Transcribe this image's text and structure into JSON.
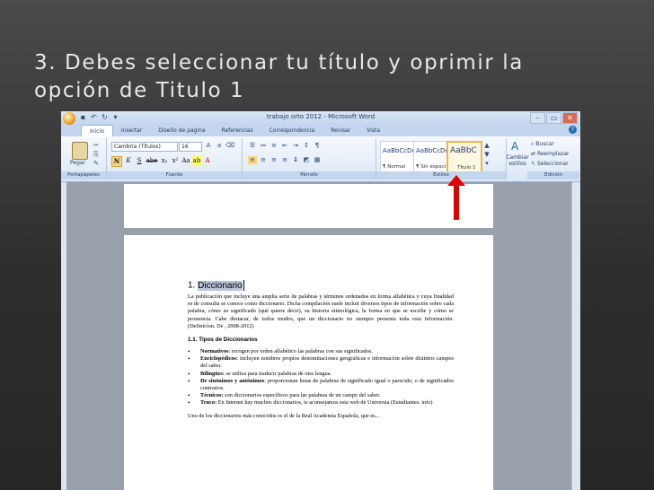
{
  "slide": {
    "title_line1": "3. Debes seleccionar tu título y oprimir la",
    "title_line2": "opción de Titulo 1"
  },
  "window": {
    "title": "trabajo orto 2012 - Microsoft Word",
    "minimize": "–",
    "maximize": "▭",
    "close": "✕"
  },
  "tabs": [
    "Inicio",
    "Insertar",
    "Diseño de página",
    "Referencias",
    "Correspondencia",
    "Revisar",
    "Vista"
  ],
  "ribbon": {
    "clipboard": {
      "paste_label": "Pegar",
      "group_label": "Portapapeles"
    },
    "font": {
      "font_name": "Cambria (Títulos)",
      "font_size": "16",
      "group_label": "Fuente",
      "bold": "N",
      "italic": "K",
      "underline": "S",
      "strike": "abe"
    },
    "paragraph": {
      "group_label": "Párrafo"
    },
    "styles": {
      "group_label": "Estilos",
      "tiles": [
        {
          "sample": "AaBbCcDc",
          "name": "¶ Normal"
        },
        {
          "sample": "AaBbCcDc",
          "name": "¶ Sin espaci..."
        },
        {
          "sample": "AaBbC",
          "name": "Título 1"
        }
      ],
      "change_styles": "Cambiar estilos"
    },
    "editing": {
      "group_label": "Edición",
      "find": "Buscar",
      "replace": "Reemplazar",
      "select": "Seleccionar"
    }
  },
  "document": {
    "heading_num": "1. ",
    "heading_text": "Diccionario",
    "intro": "La publicación que incluye una amplia serie de palabras y términos ordenados en forma alfabética y cuya finalidad es de consulta se conoce como diccionario. Dicha compilación suele incluir diversos tipos de información sobre cada palabra, cómo su significado (qué quiere decir), su historia etimológica, la forma en que se escribe y cómo se pronuncia. Cabe destacar, de todos modos, que un diccionario no siempre presenta toda esta información. (Definicion. De , 2008-2012)",
    "subheading": "1.1. Tipos de Diccionarios",
    "items": [
      {
        "term": "Normativos",
        "desc": ": recogen por orden alfabético las palabras con sus significados."
      },
      {
        "term": "Enciclopédicos:",
        "desc": " incluyen nombres propios denominaciones geográficas e información sobre distintos campos del saber."
      },
      {
        "term": "Bilingües:",
        "desc": " se utiliza para traducir palabras de otra lengua."
      },
      {
        "term": "De sinónimos y antónimos",
        "desc": ": proporcionan listas de palabras de significado igual o parecido, o de significados contrarios."
      },
      {
        "term": "Técnicos:",
        "desc": " son diccionarios específicos para las palabras de un campo del saber."
      },
      {
        "term": "Truco:",
        "desc": " En Internet hay muchos diccionarios, te aconsejamos esta web de Universia (Estudiantes. info)"
      }
    ],
    "tail": "Uno de los diccionarios más conocidos es el de la Real Academia Española, que es..."
  },
  "colors": {
    "arrow": "#e00000",
    "selected_style_border": "#e8b84a"
  }
}
